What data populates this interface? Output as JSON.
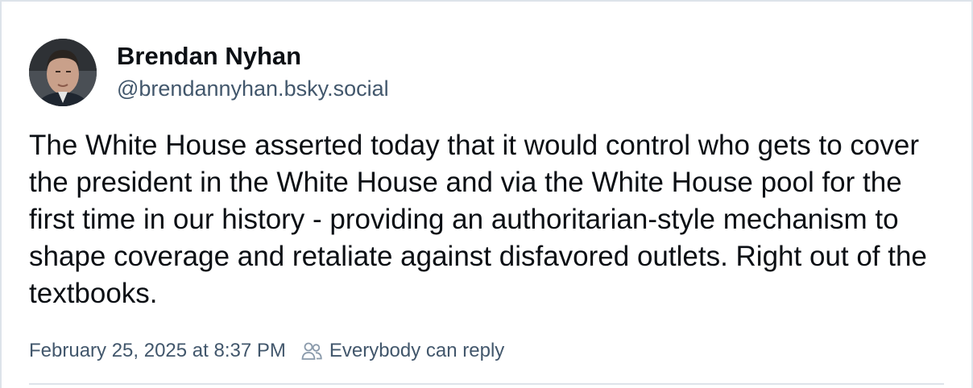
{
  "author": {
    "display_name": "Brendan Nyhan",
    "handle": "@brendannyhan.bsky.social",
    "avatar_icon": "avatar-photo"
  },
  "post": {
    "text": "The White House asserted today that it would control who gets to cover the president in the White House and via the White House pool for the first time in our history - providing an authoritarian-style mechanism to shape coverage and retaliate against disfavored outlets. Right out of the textbooks."
  },
  "meta": {
    "timestamp": "February 25, 2025 at 8:37 PM",
    "reply_setting": "Everybody can reply",
    "reply_icon": "people-icon"
  },
  "colors": {
    "text_primary": "#0b0f14",
    "text_secondary": "#42576c",
    "border": "#dde3ea"
  }
}
